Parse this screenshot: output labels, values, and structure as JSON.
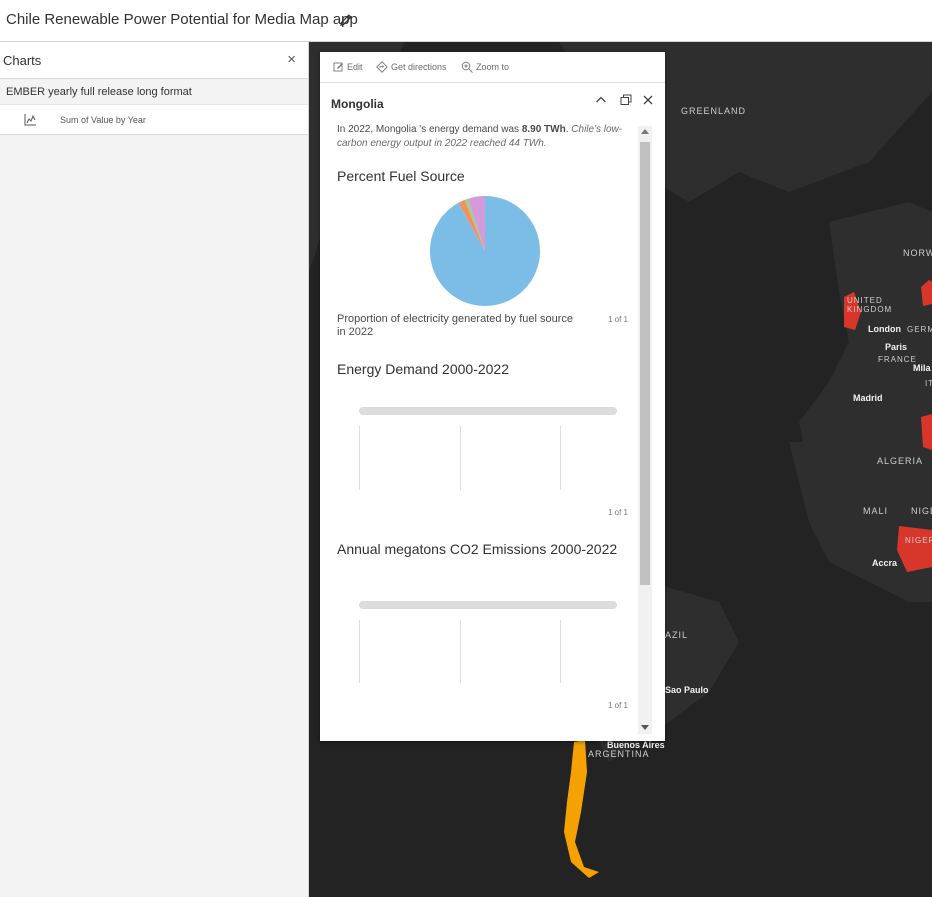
{
  "app": {
    "title": "Chile Renewable Power Potential for Media Map app"
  },
  "sidepanel": {
    "title": "Charts",
    "close_glyph": "×",
    "layer": "EMBER yearly full release long format",
    "chart_item": "Sum of Value by Year"
  },
  "map": {
    "labels": {
      "greenland": "GREENLAND",
      "norway": "NORW",
      "uk": "UNITED\nKINGDOM",
      "germany": "GERM",
      "france": "FRANCE",
      "italy": "IT",
      "algeria": "ALGERIA",
      "mali": "MALI",
      "niger": "NIGE",
      "nigeria": "NIGER",
      "brazil": "AZIL",
      "argentina": "ARGENTINA"
    },
    "cities": {
      "london": "London",
      "paris": "Paris",
      "milan": "Mila",
      "madrid": "Madrid",
      "accra": "Accra",
      "sao_paulo": "Sao Paulo",
      "buenos_aires": "Buenos Aires"
    },
    "colors": {
      "background": "#232323",
      "land": "#2f2e2f",
      "highlight_red": "#d8362b",
      "chile": "#f5a200"
    }
  },
  "popup": {
    "tools": {
      "edit": "Edit",
      "directions": "Get directions",
      "zoom": "Zoom to"
    },
    "title": "Mongolia",
    "summary": {
      "prefix": "In 2022, Mongolia 's energy demand was ",
      "value": "8.90 TWh",
      "suffix": ". ",
      "italic": "Chile's low-carbon energy output in 2022 reached 44 TWh."
    },
    "sections": [
      {
        "title": "Percent Fuel Source",
        "caption": "Proportion of electricity generated by fuel source in 2022",
        "counter": "1 of 1"
      },
      {
        "title": "Energy Demand 2000-2022",
        "counter": "1 of 1"
      },
      {
        "title": "Annual megatons CO2 Emissions 2000-2022",
        "counter": "1 of 1"
      }
    ]
  },
  "chart_data": {
    "type": "pie",
    "title": "Percent Fuel Source",
    "slices": [
      {
        "value": 92,
        "color": "#7cbde8"
      },
      {
        "value": 2,
        "color": "#f4905e"
      },
      {
        "value": 1,
        "color": "#9ed08e"
      },
      {
        "value": 5,
        "color": "#d49ad9"
      }
    ]
  }
}
